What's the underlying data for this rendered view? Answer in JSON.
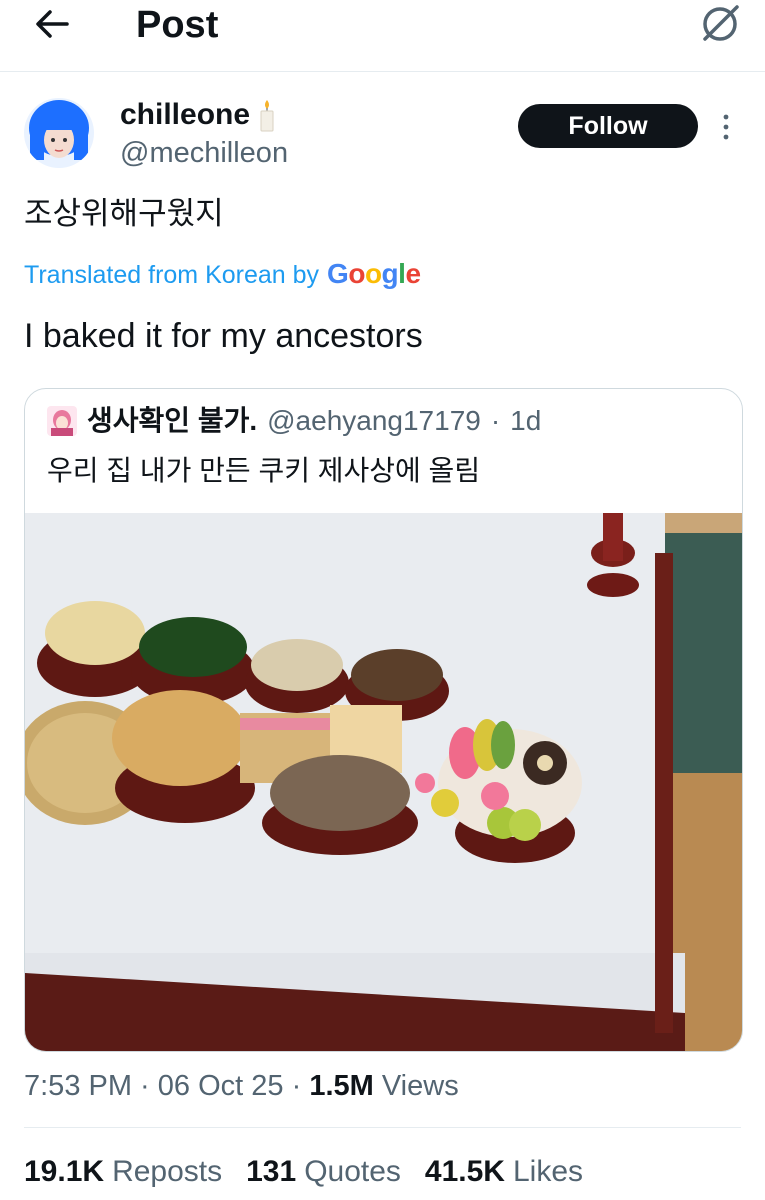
{
  "header": {
    "title": "Post",
    "back_icon": "arrow-left-icon",
    "grok_icon": "grok-icon"
  },
  "author": {
    "display_name": "chilleone",
    "emoji": "candle",
    "handle": "@mechilleon",
    "follow_label": "Follow"
  },
  "tweet": {
    "original_text": "조상위해구웠지",
    "translated_label": "Translated from Korean by",
    "translator": "Google",
    "translation": "I baked it for my ancestors"
  },
  "quote": {
    "name": "생사확인 불가.",
    "handle": "@aehyang17179",
    "time": "1d",
    "text": "우리 집 내가 만든 쿠키 제사상에 올림"
  },
  "meta": {
    "time": "7:53 PM",
    "date": "06 Oct 25",
    "views_count": "1.5M",
    "views_label": "Views"
  },
  "stats": {
    "reposts_count": "19.1K",
    "reposts_label": "Reposts",
    "quotes_count": "131",
    "quotes_label": "Quotes",
    "likes_count": "41.5K",
    "likes_label": "Likes"
  },
  "colors": {
    "accent": "#1d9bf0",
    "text": "#0f1419",
    "secondary": "#536471",
    "follow_bg": "#0f1419"
  }
}
